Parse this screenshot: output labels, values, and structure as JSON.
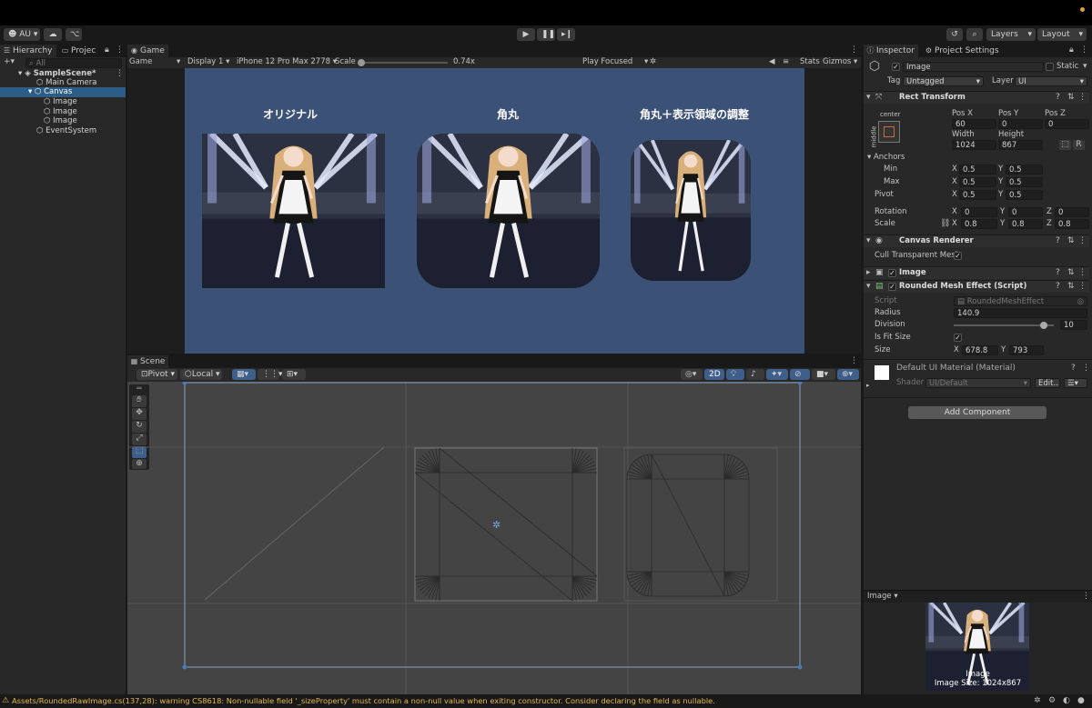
{
  "toolbar": {
    "account": "AU",
    "layers": "Layers",
    "layout": "Layout"
  },
  "hierarchy": {
    "tab": "Hierarchy",
    "tab2": "Projec",
    "search_placeholder": "All",
    "items": [
      "SampleScene*",
      "Main Camera",
      "Canvas",
      "Image",
      "Image",
      "Image",
      "EventSystem"
    ]
  },
  "game": {
    "tab": "Game",
    "mode": "Game",
    "display": "Display 1",
    "device": "iPhone 12 Pro Max",
    "resolution": "2778",
    "scale_label": "Scale",
    "scale_value": "0.74x",
    "play_focused": "Play Focused",
    "stats": "Stats",
    "gizmos": "Gizmos",
    "titles": [
      "オリジナル",
      "角丸",
      "角丸＋表示領域の調整"
    ]
  },
  "scene": {
    "tab": "Scene",
    "pivot": "Pivot",
    "space": "Local",
    "mode_2d": "2D"
  },
  "inspector": {
    "tab": "Inspector",
    "tab2": "Project Settings",
    "object_name": "Image",
    "static_label": "Static",
    "tag_label": "Tag",
    "tag_value": "Untagged",
    "layer_label": "Layer",
    "layer_value": "UI",
    "rect": {
      "title": "Rect Transform",
      "anchor_label": "center",
      "side_label": "middle",
      "posx_label": "Pos X",
      "posy_label": "Pos Y",
      "posz_label": "Pos Z",
      "posx": "60",
      "posy": "0",
      "posz": "0",
      "width_label": "Width",
      "height_label": "Height",
      "width": "1024",
      "height": "867",
      "anchors": "Anchors",
      "min": "Min",
      "max": "Max",
      "min_x": "0.5",
      "min_y": "0.5",
      "max_x": "0.5",
      "max_y": "0.5",
      "pivot": "Pivot",
      "pivot_x": "0.5",
      "pivot_y": "0.5",
      "rotation": "Rotation",
      "rot_x": "0",
      "rot_y": "0",
      "rot_z": "0",
      "scale": "Scale",
      "scale_x": "0.8",
      "scale_y": "0.8",
      "scale_z": "0.8"
    },
    "canvas_renderer": {
      "title": "Canvas Renderer",
      "cull_label": "Cull Transparent Mesh"
    },
    "image_comp": {
      "title": "Image"
    },
    "rounded": {
      "title": "Rounded Mesh Effect (Script)",
      "script_label": "Script",
      "script_value": "RoundedMeshEffect",
      "radius_label": "Radius",
      "radius": "140.9",
      "division_label": "Division",
      "division": "10",
      "division_fraction": 0.9,
      "isfit_label": "Is Fit Size",
      "size_label": "Size",
      "size_x": "678.8",
      "size_y": "793"
    },
    "material": {
      "title": "Default UI Material (Material)",
      "shader_label": "Shader",
      "shader_value": "UI/Default",
      "edit": "Edit..."
    },
    "add_component": "Add Component",
    "preview": {
      "title": "Image",
      "caption1": "Image",
      "caption2": "Image Size: 1024x867"
    }
  },
  "status": {
    "message": "Assets/RoundedRawImage.cs(137,28): warning CS8618: Non-nullable field '_sizeProperty' must contain a non-null value when exiting constructor. Consider declaring the field as nullable."
  },
  "colors": {
    "accent": "#3e5f8a",
    "game_bg": "#3b5175",
    "panel": "#282828",
    "warning": "#e8b84a"
  }
}
